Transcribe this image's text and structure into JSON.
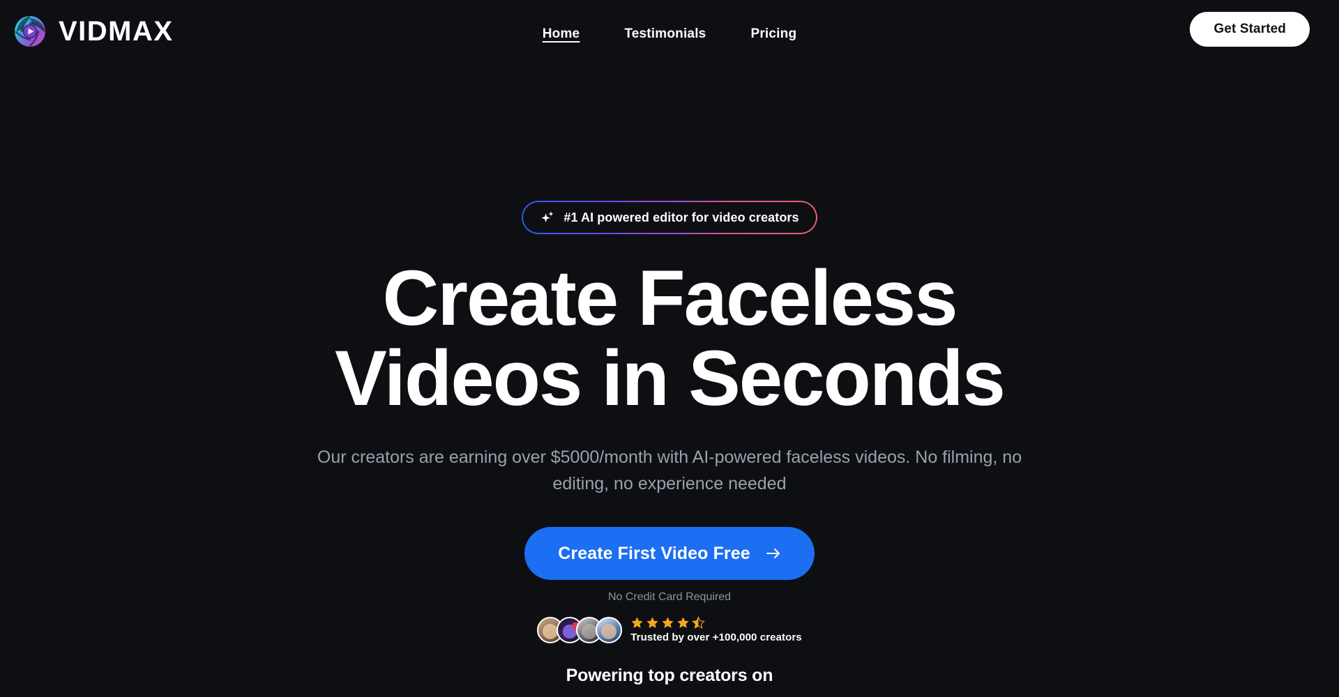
{
  "theme": {
    "background": "#0e0f13",
    "accent_blue": "#1c6ef2",
    "text_primary": "#ffffff",
    "text_muted": "#9ba0ad",
    "star_gold": "#f5a623",
    "badge_gradient_start": "#2f5cf0",
    "badge_gradient_mid": "#a449d8",
    "badge_gradient_end": "#f2626e"
  },
  "header": {
    "logo_icon": "aperture-play-icon",
    "brand": "VIDMAX",
    "nav": [
      {
        "label": "Home",
        "active": true
      },
      {
        "label": "Testimonials",
        "active": false
      },
      {
        "label": "Pricing",
        "active": false
      }
    ],
    "cta_label": "Get Started"
  },
  "hero": {
    "badge": {
      "icon": "sparkle-icon",
      "text": "#1 AI powered editor for video creators"
    },
    "headline_line1": "Create Faceless",
    "headline_line2": "Videos in Seconds",
    "subtitle": "Our creators are earning over $5000/month with AI-powered faceless videos. No filming, no editing, no experience needed",
    "cta_label": "Create First Video Free",
    "cta_icon": "arrow-right-icon",
    "no_card_note": "No Credit Card Required"
  },
  "social_proof": {
    "avatars": [
      {
        "alt": "creator-avatar-1"
      },
      {
        "alt": "creator-avatar-2"
      },
      {
        "alt": "creator-avatar-3"
      },
      {
        "alt": "creator-avatar-4"
      }
    ],
    "rating_value": 4.5,
    "stars_full": 4,
    "stars_half": 1,
    "trusted_text": "Trusted by over +100,000 creators"
  },
  "logos_section": {
    "heading": "Powering top creators on"
  }
}
